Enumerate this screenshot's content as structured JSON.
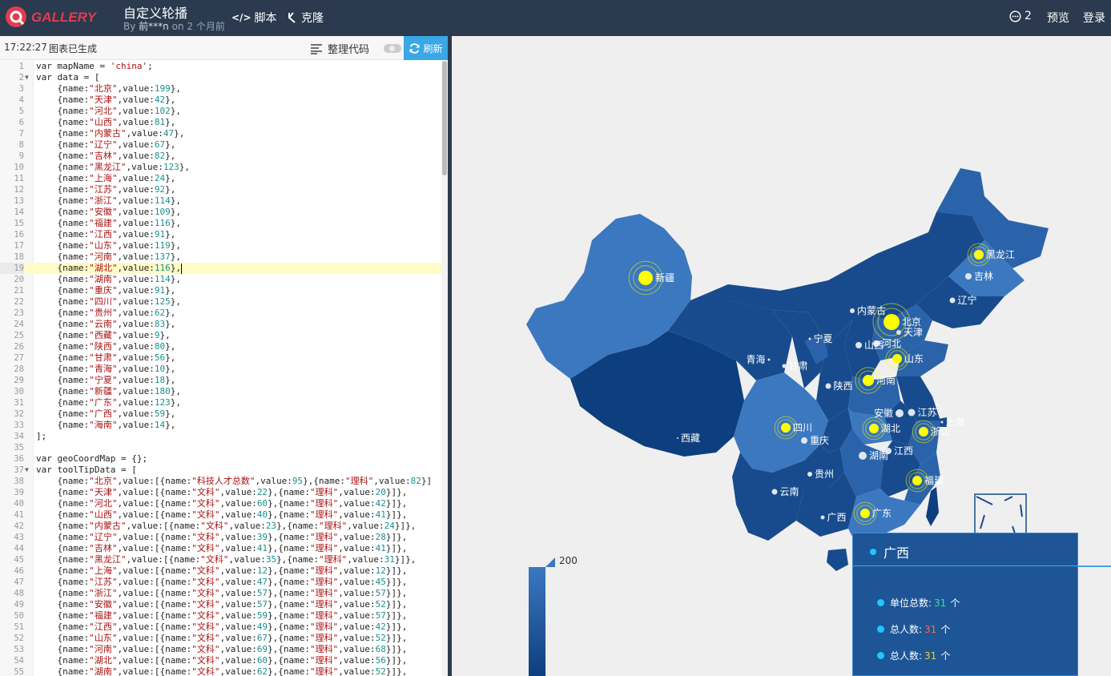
{
  "topbar": {
    "brand": "GALLERY",
    "title": "自定义轮播",
    "author": "前***n",
    "time_prefix": "By",
    "time_suffix": "on 2 个月前",
    "script_label": "脚本",
    "clone_label": "克隆",
    "comment_count": "2",
    "preview_label": "预览",
    "login_label": "登录"
  },
  "toolbar": {
    "time": "17:22:27",
    "message": "图表已生成",
    "format_label": "整理代码",
    "refresh_label": "刷新"
  },
  "code": {
    "lines": [
      "var mapName = 'china';",
      "var data = [",
      "    {name:\"北京\",value:199},",
      "    {name:\"天津\",value:42},",
      "    {name:\"河北\",value:102},",
      "    {name:\"山西\",value:81},",
      "    {name:\"内蒙古\",value:47},",
      "    {name:\"辽宁\",value:67},",
      "    {name:\"吉林\",value:82},",
      "    {name:\"黑龙江\",value:123},",
      "    {name:\"上海\",value:24},",
      "    {name:\"江苏\",value:92},",
      "    {name:\"浙江\",value:114},",
      "    {name:\"安徽\",value:109},",
      "    {name:\"福建\",value:116},",
      "    {name:\"江西\",value:91},",
      "    {name:\"山东\",value:119},",
      "    {name:\"河南\",value:137},",
      "    {name:\"湖北\",value:116},",
      "    {name:\"湖南\",value:114},",
      "    {name:\"重庆\",value:91},",
      "    {name:\"四川\",value:125},",
      "    {name:\"贵州\",value:62},",
      "    {name:\"云南\",value:83},",
      "    {name:\"西藏\",value:9},",
      "    {name:\"陕西\",value:80},",
      "    {name:\"甘肃\",value:56},",
      "    {name:\"青海\",value:10},",
      "    {name:\"宁夏\",value:18},",
      "    {name:\"新疆\",value:180},",
      "    {name:\"广东\",value:123},",
      "    {name:\"广西\",value:59},",
      "    {name:\"海南\",value:14},",
      "];",
      "",
      "var geoCoordMap = {};",
      "var toolTipData = [",
      "    {name:\"北京\",value:[{name:\"科技人才总数\",value:95},{name:\"理科\",value:82}]",
      "    {name:\"天津\",value:[{name:\"文科\",value:22},{name:\"理科\",value:20}]},",
      "    {name:\"河北\",value:[{name:\"文科\",value:60},{name:\"理科\",value:42}]},",
      "    {name:\"山西\",value:[{name:\"文科\",value:40},{name:\"理科\",value:41}]},",
      "    {name:\"内蒙古\",value:[{name:\"文科\",value:23},{name:\"理科\",value:24}]},",
      "    {name:\"辽宁\",value:[{name:\"文科\",value:39},{name:\"理科\",value:28}]},",
      "    {name:\"吉林\",value:[{name:\"文科\",value:41},{name:\"理科\",value:41}]},",
      "    {name:\"黑龙江\",value:[{name:\"文科\",value:35},{name:\"理科\",value:31}]},",
      "    {name:\"上海\",value:[{name:\"文科\",value:12},{name:\"理科\",value:12}]},",
      "    {name:\"江苏\",value:[{name:\"文科\",value:47},{name:\"理科\",value:45}]},",
      "    {name:\"浙江\",value:[{name:\"文科\",value:57},{name:\"理科\",value:57}]},",
      "    {name:\"安徽\",value:[{name:\"文科\",value:57},{name:\"理科\",value:52}]},",
      "    {name:\"福建\",value:[{name:\"文科\",value:59},{name:\"理科\",value:57}]},",
      "    {name:\"江西\",value:[{name:\"文科\",value:49},{name:\"理科\",value:42}]},",
      "    {name:\"山东\",value:[{name:\"文科\",value:67},{name:\"理科\",value:52}]},",
      "    {name:\"河南\",value:[{name:\"文科\",value:69},{name:\"理科\",value:68}]},",
      "    {name:\"湖北\",value:[{name:\"文科\",value:60},{name:\"理科\",value:56}]},",
      "    {name:\"湖南\",value:[{name:\"文科\",value:62},{name:\"理科\",value:52}]},"
    ],
    "highlight_line": 19
  },
  "map": {
    "provinces": [
      {
        "name": "新疆",
        "effect": true
      },
      {
        "name": "黑龙江",
        "effect": true
      },
      {
        "name": "吉林",
        "effect": false
      },
      {
        "name": "辽宁",
        "effect": false
      },
      {
        "name": "内蒙古",
        "effect": false
      },
      {
        "name": "北京",
        "effect": true
      },
      {
        "name": "天津",
        "effect": false
      },
      {
        "name": "宁夏",
        "effect": false
      },
      {
        "name": "山西",
        "effect": false
      },
      {
        "name": "河北",
        "effect": false
      },
      {
        "name": "青海",
        "effect": false
      },
      {
        "name": "甘肃",
        "effect": false
      },
      {
        "name": "山东",
        "effect": true
      },
      {
        "name": "陕西",
        "effect": false
      },
      {
        "name": "河南",
        "effect": true
      },
      {
        "name": "安徽",
        "effect": false
      },
      {
        "name": "江苏",
        "effect": false
      },
      {
        "name": "上海",
        "effect": false
      },
      {
        "name": "西藏",
        "effect": false
      },
      {
        "name": "四川",
        "effect": true
      },
      {
        "name": "湖北",
        "effect": true
      },
      {
        "name": "浙江",
        "effect": true
      },
      {
        "name": "重庆",
        "effect": false
      },
      {
        "name": "江西",
        "effect": false
      },
      {
        "name": "湖南",
        "effect": false
      },
      {
        "name": "贵州",
        "effect": false
      },
      {
        "name": "云南",
        "effect": false
      },
      {
        "name": "福建",
        "effect": true
      },
      {
        "name": "广西",
        "effect": false
      },
      {
        "name": "广东",
        "effect": true
      }
    ],
    "legend_max": "200",
    "colors": {
      "dark": "#0d3e7e",
      "mid": "#174b8d",
      "light": "#3b78c0",
      "effect": "#ffff00",
      "label": "#ffffff"
    }
  },
  "tooltip": {
    "province": "广西",
    "rows": [
      {
        "label": "单位总数:",
        "value": "31",
        "unit": "个",
        "color": "#3de38a"
      },
      {
        "label": "总人数:",
        "value": "31",
        "unit": "个",
        "color": "#ff6a3d"
      },
      {
        "label": "总人数:",
        "value": "31",
        "unit": "个",
        "color": "#f4d22b"
      }
    ]
  }
}
